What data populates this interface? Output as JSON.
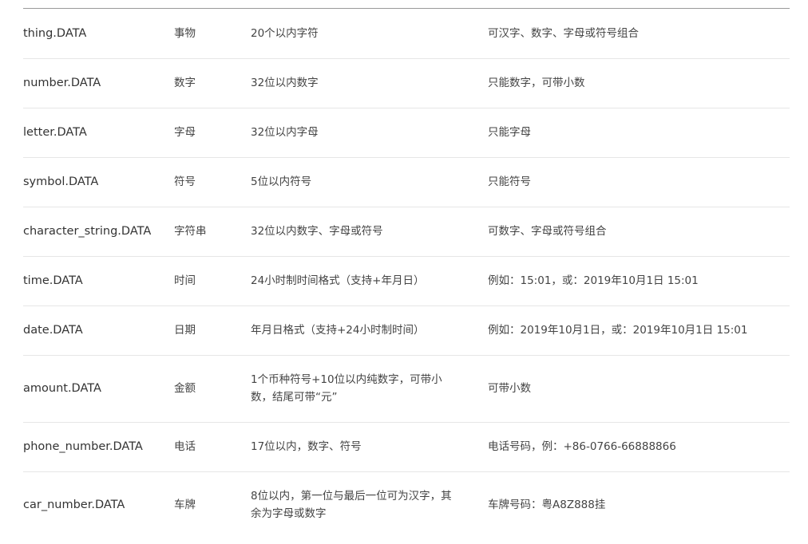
{
  "rows": [
    {
      "name": "thing.DATA",
      "type": "事物",
      "length": "20个以内字符",
      "requirement": "可汉字、数字、字母或符号组合"
    },
    {
      "name": "number.DATA",
      "type": "数字",
      "length": "32位以内数字",
      "requirement": "只能数字，可带小数"
    },
    {
      "name": "letter.DATA",
      "type": "字母",
      "length": "32位以内字母",
      "requirement": "只能字母"
    },
    {
      "name": "symbol.DATA",
      "type": "符号",
      "length": "5位以内符号",
      "requirement": "只能符号"
    },
    {
      "name": "character_string.DATA",
      "type": "字符串",
      "length": "32位以内数字、字母或符号",
      "requirement": "可数字、字母或符号组合"
    },
    {
      "name": "time.DATA",
      "type": "时间",
      "length": "24小时制时间格式（支持+年月日）",
      "requirement": "例如：15:01，或：2019年10月1日 15:01"
    },
    {
      "name": "date.DATA",
      "type": "日期",
      "length": "年月日格式（支持+24小时制时间）",
      "requirement": "例如：2019年10月1日，或：2019年10月1日 15:01"
    },
    {
      "name": "amount.DATA",
      "type": "金额",
      "length": "1个币种符号+10位以内纯数字，可带小数，结尾可带“元”",
      "requirement": "可带小数"
    },
    {
      "name": "phone_number.DATA",
      "type": "电话",
      "length": "17位以内，数字、符号",
      "requirement": "电话号码，例：+86-0766-66888866"
    },
    {
      "name": "car_number.DATA",
      "type": "车牌",
      "length": "8位以内，第一位与最后一位可为汉字，其余为字母或数字",
      "requirement": "车牌号码：粤A8Z888挂"
    }
  ]
}
